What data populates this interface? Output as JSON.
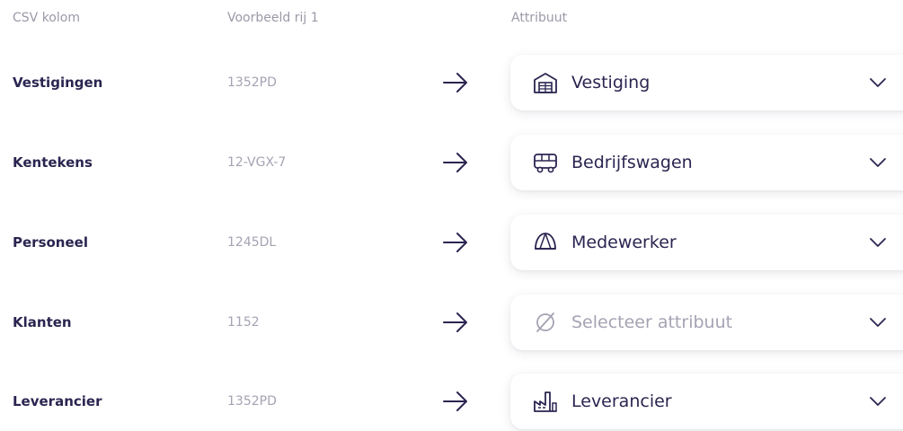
{
  "header": {
    "csv_column": "CSV kolom",
    "sample_row": "Voorbeeld rij 1",
    "attribute": "Attribuut"
  },
  "rows": [
    {
      "column": "Vestigingen",
      "sample": "1352PD",
      "attribute": "Vestiging",
      "icon": "warehouse-icon",
      "placeholder": false
    },
    {
      "column": "Kentekens",
      "sample": "12-VGX-7",
      "attribute": "Bedrijfswagen",
      "icon": "van-icon",
      "placeholder": false
    },
    {
      "column": "Personeel",
      "sample": "1245DL",
      "attribute": "Medewerker",
      "icon": "cap-icon",
      "placeholder": false
    },
    {
      "column": "Klanten",
      "sample": "1152",
      "attribute": "Selecteer attribuut",
      "icon": "empty-set-icon",
      "placeholder": true
    },
    {
      "column": "Leverancier",
      "sample": "1352PD",
      "attribute": "Leverancier",
      "icon": "factory-icon",
      "placeholder": false
    }
  ],
  "colors": {
    "text_primary": "#2a2550",
    "text_muted": "#a4a3b3",
    "header": "#9a9aa8",
    "background": "#ffffff"
  }
}
